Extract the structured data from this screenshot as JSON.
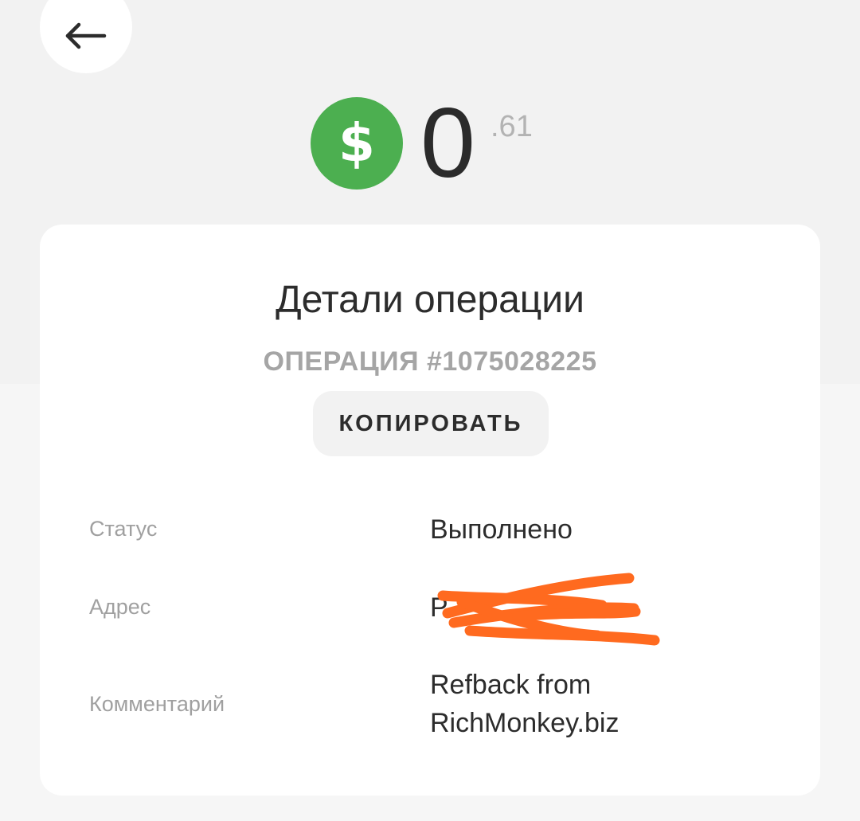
{
  "header": {
    "back_icon": "arrow-left-icon"
  },
  "balance": {
    "currency_symbol": "$",
    "currency_icon": "dollar-icon",
    "currency_color": "#4caf50",
    "integer_part": "0",
    "fraction_part": ".61"
  },
  "details": {
    "title": "Детали операции",
    "operation_label": "ОПЕРАЦИЯ #1075028225",
    "copy_label": "КОПИРОВАТЬ",
    "rows": [
      {
        "label": "Статус",
        "value": "Выполнено"
      },
      {
        "label": "Адрес",
        "value": "P",
        "redaction_color": "#ff6a1f"
      },
      {
        "label": "Комментарий",
        "value_line1": "Refback from",
        "value_line2": "RichMonkey.biz"
      }
    ]
  }
}
